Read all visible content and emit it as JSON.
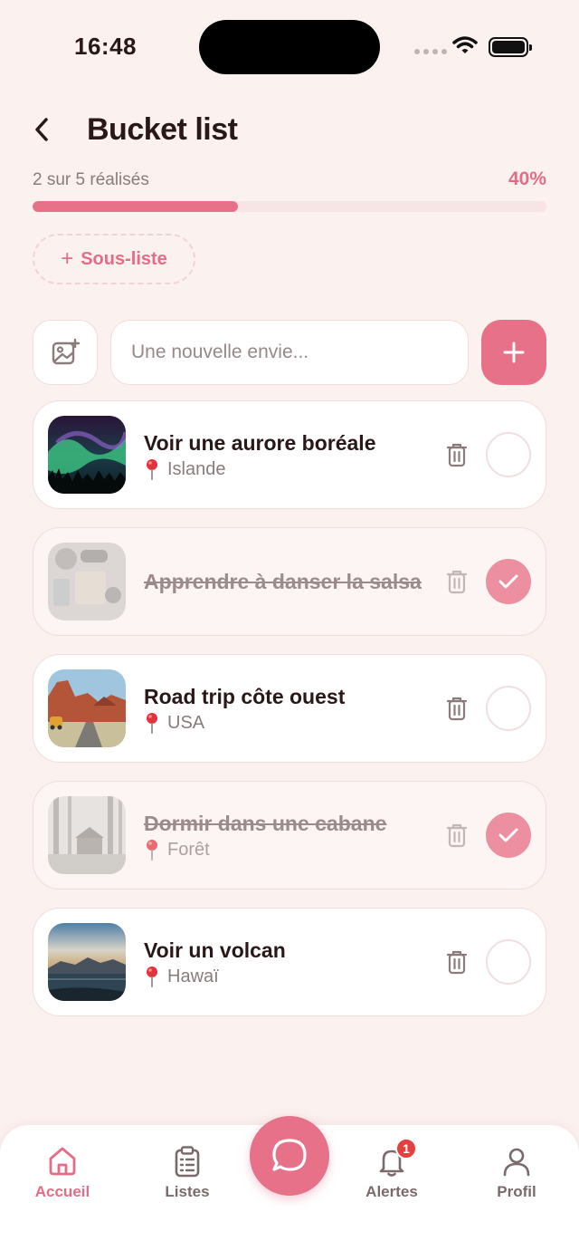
{
  "status_bar": {
    "time": "16:48"
  },
  "header": {
    "title": "Bucket list"
  },
  "progress": {
    "text": "2 sur 5 réalisés",
    "percent_label": "40%",
    "fraction": 0.4
  },
  "sublist_button": {
    "plus": "+",
    "label": "Sous-liste"
  },
  "new_item": {
    "placeholder": "Une nouvelle envie..."
  },
  "items": [
    {
      "title": "Voir une aurore boréale",
      "location": "Islande",
      "done": false,
      "image": "aurora-photo"
    },
    {
      "title": "Apprendre à danser la salsa",
      "location": "",
      "done": true,
      "image": "dance-items-photo"
    },
    {
      "title": "Road trip côte ouest",
      "location": "USA",
      "done": false,
      "image": "desert-road-photo"
    },
    {
      "title": "Dormir dans une cabane",
      "location": "Forêt",
      "done": true,
      "image": "forest-cabin-photo"
    },
    {
      "title": "Voir un volcan",
      "location": "Hawaï",
      "done": false,
      "image": "volcano-lake-photo"
    }
  ],
  "tabbar": {
    "tabs": [
      {
        "label": "Accueil",
        "icon": "home-icon",
        "active": true
      },
      {
        "label": "Listes",
        "icon": "clipboard-icon",
        "active": false
      },
      {
        "label": "Alertes",
        "icon": "bell-icon",
        "active": false,
        "badge": "1"
      },
      {
        "label": "Profil",
        "icon": "user-icon",
        "active": false
      }
    ],
    "center_icon": "chat-bubble-icon"
  },
  "colors": {
    "accent": "#e8718a",
    "background": "#fbf1ef",
    "text": "#2a1718",
    "muted": "#8b7b7c",
    "badge": "#e3403f"
  }
}
